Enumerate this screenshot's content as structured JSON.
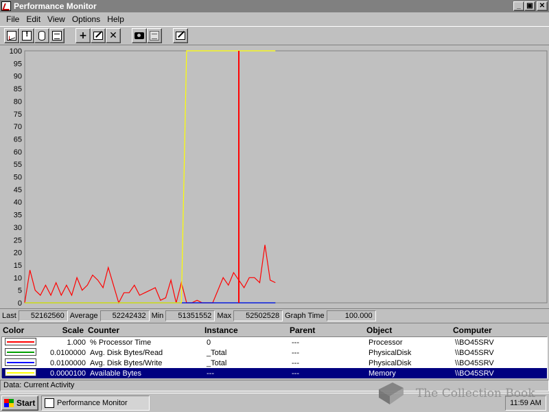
{
  "window": {
    "title": "Performance Monitor",
    "buttons": {
      "minimize": "_",
      "maximize": "▣",
      "close": "✕"
    }
  },
  "menu": [
    {
      "label": "File"
    },
    {
      "label": "Edit"
    },
    {
      "label": "View"
    },
    {
      "label": "Options"
    },
    {
      "label": "Help"
    }
  ],
  "toolbar": {
    "groups": [
      [
        {
          "icon": "chart-view-icon"
        },
        {
          "icon": "alert-view-icon"
        },
        {
          "icon": "log-view-icon"
        },
        {
          "icon": "report-view-icon"
        }
      ],
      [
        {
          "icon": "add-counter-icon",
          "glyph": "+"
        },
        {
          "icon": "edit-counter-icon"
        },
        {
          "icon": "delete-counter-icon",
          "glyph": "✕"
        }
      ],
      [
        {
          "icon": "update-now-icon"
        },
        {
          "icon": "bookmark-icon",
          "disabled": true
        }
      ],
      [
        {
          "icon": "options-icon"
        }
      ]
    ]
  },
  "graph": {
    "y_ticks": [
      "100",
      "95",
      "90",
      "85",
      "80",
      "75",
      "70",
      "65",
      "60",
      "55",
      "50",
      "45",
      "40",
      "35",
      "30",
      "25",
      "20",
      "15",
      "10",
      "5",
      "0"
    ]
  },
  "chart_data": {
    "type": "line",
    "ylim": [
      0,
      100
    ],
    "grid": false,
    "samples_total": 100,
    "current_sample": 41,
    "series": [
      {
        "color": "#ff0000",
        "values": [
          0,
          13,
          5,
          3,
          7,
          3,
          8,
          3,
          7,
          3,
          10,
          5,
          7,
          11,
          9,
          6,
          14,
          7,
          0,
          4,
          4,
          7,
          3,
          4,
          5,
          6,
          1,
          2,
          9,
          0,
          8,
          0,
          0,
          1,
          0,
          0,
          0,
          5,
          10,
          7,
          12,
          9,
          6,
          10,
          10,
          8,
          23,
          9,
          8
        ]
      },
      {
        "color": "#00a000",
        "values": [
          0,
          0,
          0,
          0,
          0,
          0,
          0,
          0,
          0,
          0,
          0,
          0,
          0,
          0,
          0,
          0,
          0,
          0,
          0,
          0,
          0,
          0,
          0,
          0,
          0,
          0,
          0,
          0,
          0,
          0,
          0,
          0,
          0,
          0,
          0,
          0,
          0,
          0,
          0,
          0,
          0,
          0,
          0,
          0,
          0,
          0,
          0,
          0,
          0
        ]
      },
      {
        "color": "#0000ff",
        "values": [
          0,
          0,
          0,
          0,
          0,
          0,
          0,
          0,
          0,
          0,
          0,
          0,
          0,
          0,
          0,
          0,
          0,
          0,
          0,
          0,
          0,
          0,
          0,
          0,
          0,
          0,
          0,
          0,
          0,
          0,
          0,
          0,
          0,
          0,
          0,
          0,
          0,
          0,
          0,
          0,
          0,
          0,
          0,
          0,
          0,
          0,
          0,
          0,
          0
        ]
      },
      {
        "color": "#ffff00",
        "values": [
          0,
          0,
          0,
          0,
          0,
          0,
          0,
          0,
          0,
          0,
          0,
          0,
          0,
          0,
          0,
          0,
          0,
          0,
          0,
          0,
          0,
          0,
          0,
          0,
          0,
          0,
          0,
          0,
          0,
          0,
          0,
          100,
          100,
          100,
          100,
          100,
          100,
          100,
          100,
          100,
          100,
          100,
          100,
          100,
          100,
          100,
          100,
          100,
          100
        ]
      }
    ]
  },
  "values": {
    "last_label": "Last",
    "last": "52162560",
    "average_label": "Average",
    "average": "52242432",
    "min_label": "Min",
    "min": "51351552",
    "max_label": "Max",
    "max": "52502528",
    "graph_time_label": "Graph Time",
    "graph_time": "100.000"
  },
  "legend": {
    "headers": {
      "color": "Color",
      "scale": "Scale",
      "counter": "Counter",
      "instance": "Instance",
      "parent": "Parent",
      "object": "Object",
      "computer": "Computer"
    },
    "rows": [
      {
        "color": "#ff0000",
        "scale": "1.000",
        "counter": "% Processor Time",
        "instance": "0",
        "parent": "---",
        "object": "Processor",
        "computer": "\\\\BO45SRV"
      },
      {
        "color": "#00a000",
        "scale": "0.0100000",
        "counter": "Avg. Disk Bytes/Read",
        "instance": "_Total",
        "parent": "---",
        "object": "PhysicalDisk",
        "computer": "\\\\BO45SRV"
      },
      {
        "color": "#0000ff",
        "scale": "0.0100000",
        "counter": "Avg. Disk Bytes/Write",
        "instance": "_Total",
        "parent": "---",
        "object": "PhysicalDisk",
        "computer": "\\\\BO45SRV"
      },
      {
        "color": "#ffff00",
        "scale": "0.0000100",
        "counter": "Available Bytes",
        "instance": "---",
        "parent": "---",
        "object": "Memory",
        "computer": "\\\\BO45SRV",
        "selected": true
      }
    ]
  },
  "status": {
    "text": "Data: Current Activity"
  },
  "taskbar": {
    "start_label": "Start",
    "task_label": "Performance Monitor",
    "clock": "11:59 AM"
  },
  "watermark": {
    "text": "The Collection Book"
  }
}
